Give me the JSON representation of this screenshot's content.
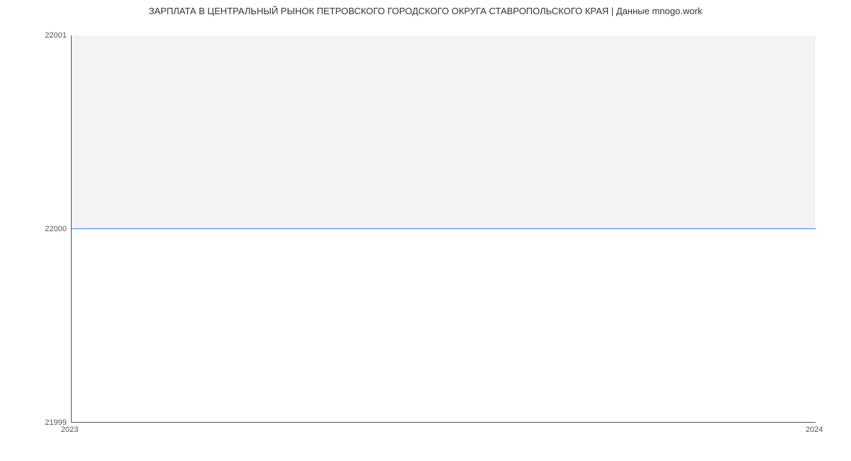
{
  "chart_data": {
    "type": "line",
    "title": "ЗАРПЛАТА В ЦЕНТРАЛЬНЫЙ РЫНОК ПЕТРОВСКОГО ГОРОДСКОГО ОКРУГА СТАВРОПОЛЬСКОГО КРАЯ | Данные mnogo.work",
    "x": [
      2023,
      2024
    ],
    "values": [
      22000,
      22000
    ],
    "xlabel": "",
    "ylabel": "",
    "ylim": [
      21999,
      22001
    ],
    "xlim": [
      2023,
      2024
    ],
    "y_ticks": [
      "21999",
      "22000",
      "22001"
    ],
    "x_ticks": [
      "2023",
      "2024"
    ],
    "fill": true,
    "line_color": "#3b82f6",
    "fill_color": "#f3f3f3"
  }
}
